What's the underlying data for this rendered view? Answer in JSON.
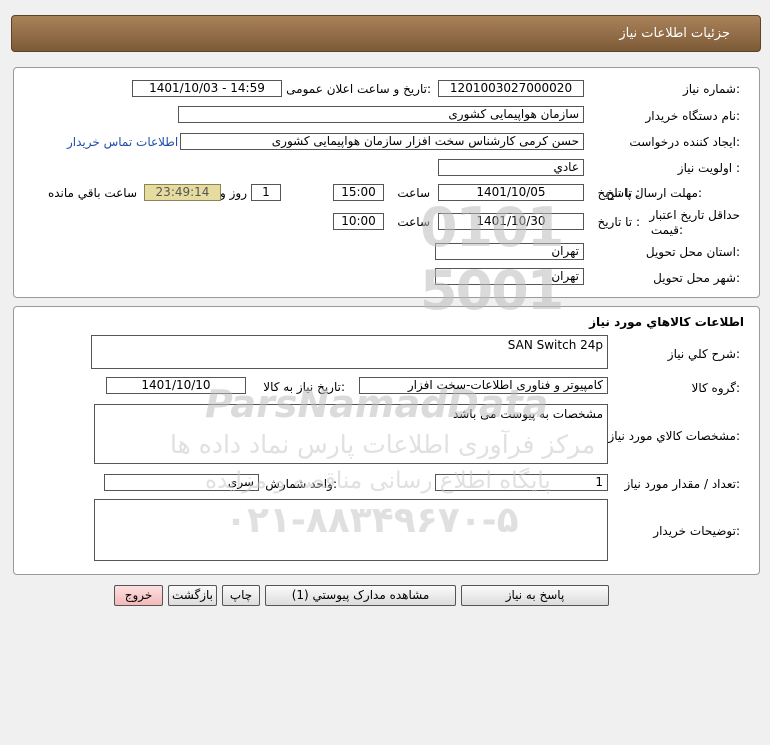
{
  "header": {
    "title": "جزئیات اطلاعات نیاز"
  },
  "need_info": {
    "need_number_label": "شماره نیاز:",
    "need_number": "1201003027000020",
    "announce_label": "تاریخ و ساعت اعلان عمومی:",
    "announce_value": "1401/10/03 - 14:59",
    "buyer_org_label": "نام دستگاه خریدار:",
    "buyer_org": "سازمان هواپیمایی کشوری",
    "creator_label": "ایجاد کننده درخواست:",
    "creator": "حسن کرمی کارشناس سخت افزار سازمان هواپیمایی کشوری",
    "contact_link": "اطلاعات تماس خریدار",
    "priority_label": "اولویت نیاز :",
    "priority": "عادي",
    "deadline_label": "مهلت ارسال پاسخ:",
    "to_date_label": "تا تاریخ :",
    "deadline_date": "1401/10/05",
    "time_label": "ساعت",
    "deadline_time": "15:00",
    "days": "1",
    "days_label": "روز و",
    "remaining_time": "23:49:14",
    "remaining_label": "ساعت باقي مانده",
    "validity_label_1": "حداقل تاریخ اعتبار",
    "validity_label_2": "قیمت:",
    "validity_to_label": "تا تاریخ :",
    "validity_date": "1401/10/30",
    "validity_time_label": "ساعت",
    "validity_time": "10:00",
    "delivery_province_label": "استان محل تحویل:",
    "delivery_province": "تهران",
    "delivery_city_label": "شهر محل تحویل:",
    "delivery_city": "تهران"
  },
  "goods": {
    "section_title": "اطلاعات کالاهاي مورد نياز",
    "general_desc_label": "شرح کلي نیاز:",
    "general_desc": "SAN Switch 24p",
    "group_label": "گروه کالا:",
    "group": "کامپیوتر و فناوری اطلاعات-سخت افزار",
    "need_date_label": "تاریخ نیاز به کالا:",
    "need_date": "1401/10/10",
    "specs_label": "مشخصات کالاي مورد نیاز:",
    "specs": "مشخصات به پیوست می باشد",
    "qty_label": "تعداد / مقدار مورد نیاز:",
    "qty": "1",
    "unit_label": "واحد شمارش:",
    "unit": "سری",
    "buyer_notes_label": "توضیحات خریدار:",
    "buyer_notes": ""
  },
  "buttons": {
    "reply": "پاسخ به نیاز",
    "view_docs": "مشاهده مدارک پیوستي (1)",
    "print": "چاپ",
    "back": "بازگشت",
    "exit": "خروج"
  },
  "watermark": {
    "brand": "ParsNamadData",
    "line1": "مرکز فرآوری اطلاعات پارس نماد داده ها",
    "line2": "پایگاه اطلاع رسانی مناقصه و مزایده",
    "phone": "۰۲۱-۸۸۳۴۹۶۷۰-۵"
  },
  "colors": {
    "header_bg": "#8d6a45",
    "timer_bg": "#e6dca0",
    "exit_bg": "#f7c6c6",
    "link": "#1f4fa8"
  }
}
